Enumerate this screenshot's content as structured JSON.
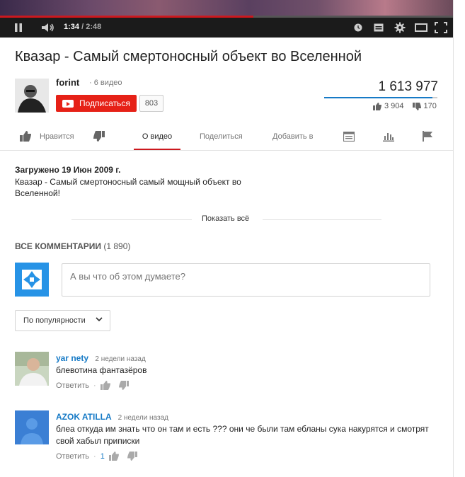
{
  "player": {
    "time_current": "1:34",
    "time_total": "/ 2:48",
    "progress_fraction": 0.56
  },
  "video": {
    "title": "Квазар - Самый смертоносный объект во Вселенной",
    "channel_name": "forint",
    "channel_video_count": "· 6 видео",
    "subscribe_label": "Подписаться",
    "subscriber_count": "803",
    "views": "1 613 977",
    "likes": "3 904",
    "dislikes": "170",
    "like_fraction": 0.958
  },
  "actions": {
    "like_label": "Нравится",
    "about_tab": "О видео",
    "share_tab": "Поделиться",
    "add_tab": "Добавить в"
  },
  "description": {
    "uploaded": "Загружено 19 Июн 2009 г.",
    "text": "Квазар - Самый смертоносный самый мощный объект во Вселенной!",
    "show_all": "Показать всё"
  },
  "comments": {
    "heading": "ВСЕ КОММЕНТАРИИ",
    "count": "(1 890)",
    "placeholder": "А вы что об этом думаете?",
    "sort_label": "По популярности",
    "reply_label": "Ответить",
    "items": [
      {
        "author": "yar nety",
        "time": "2 недели назад",
        "text": "блевотина фантазёров",
        "likes": ""
      },
      {
        "author": "AZOK ATILLA",
        "time": "2 недели назад",
        "text": "блеа откуда им знать что он там и есть ???  они че были там  ебланы сука накурятся и смотрят свой хабыл приписки",
        "likes": "1"
      }
    ]
  },
  "colors": {
    "accent_red": "#cc181e",
    "subscribe_red": "#e62117",
    "link_blue": "#167ac6"
  }
}
